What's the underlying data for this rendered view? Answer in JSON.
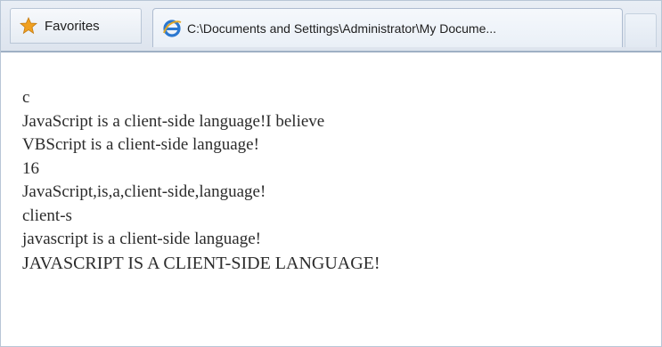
{
  "toolbar": {
    "favorites_label": "Favorites",
    "tab_title": "C:\\Documents and Settings\\Administrator\\My Docume..."
  },
  "icons": {
    "favorites": "star-icon",
    "tab": "internet-explorer-icon"
  },
  "colors": {
    "star": "#f0a020",
    "ie_logo": "#2b78d0",
    "text": "#2b2b2b"
  },
  "output_lines": [
    "c",
    "JavaScript is a client-side language!I believe",
    "VBScript is a client-side language!",
    "16",
    "JavaScript,is,a,client-side,language!",
    "client-s",
    "javascript is a client-side language!",
    "JAVASCRIPT IS A CLIENT-SIDE LANGUAGE!"
  ]
}
